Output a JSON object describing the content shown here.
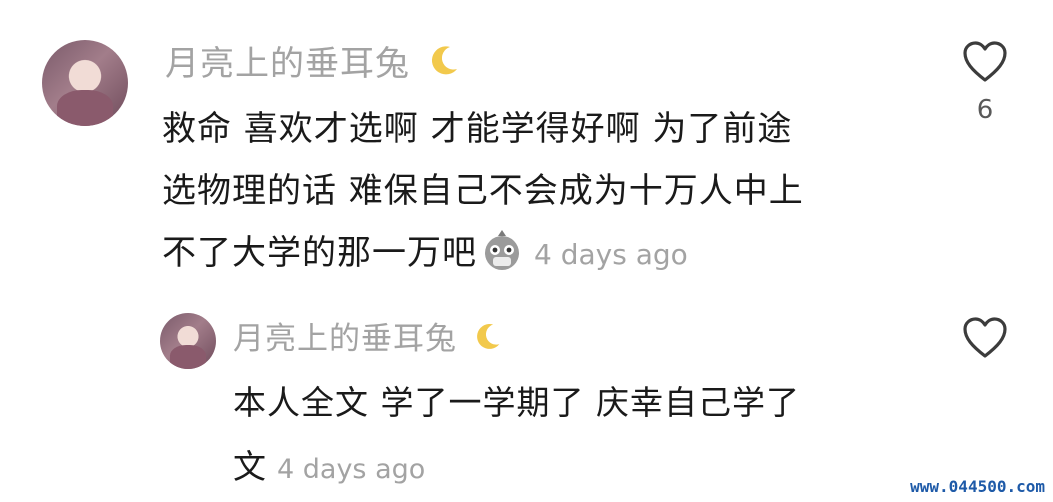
{
  "comments": [
    {
      "username": "月亮上的垂耳兔",
      "avatar_icon": "avatar",
      "username_emoji_icon": "crescent-moon-icon",
      "text_lines": [
        "救命 喜欢才选啊 才能学得好啊 为了前途",
        "选物理的话 难保自己不会成为十万人中上",
        "不了大学的那一万吧"
      ],
      "inline_emoji_icon": "face-mask-emoji-icon",
      "time": "4 days ago",
      "like_icon": "heart-icon",
      "likes": "6"
    },
    {
      "username": "月亮上的垂耳兔",
      "avatar_icon": "avatar",
      "username_emoji_icon": "crescent-moon-icon",
      "text_lines": [
        "本人全文 学了一学期了 庆幸自己学了",
        "文"
      ],
      "time": "4 days ago",
      "like_icon": "heart-icon",
      "likes": ""
    }
  ],
  "watermark": "www.044500.com",
  "colors": {
    "text_primary": "#1a1a1a",
    "text_secondary": "#a3a3a3",
    "moon": "#f2c94c",
    "watermark": "#1e5aa8"
  }
}
